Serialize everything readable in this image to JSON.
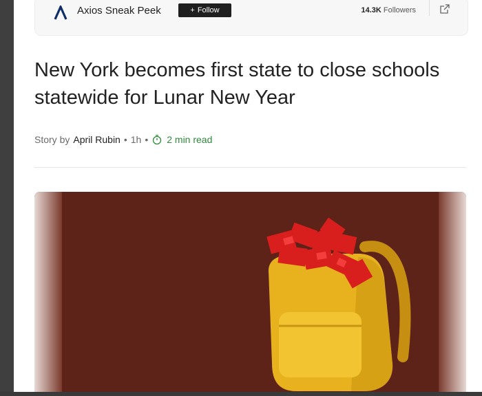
{
  "publisher": {
    "name": "Axios Sneak Peek",
    "follow_label": "Follow",
    "followers_count": "14.3K",
    "followers_label": "Followers"
  },
  "article": {
    "headline": "New York becomes first state to close schools statewide for Lunar New Year",
    "byline_prefix": "Story by",
    "author": "April Rubin",
    "age": "1h",
    "read_time": "2 min read"
  },
  "icons": {
    "publisher_logo": "axios-logo-icon",
    "follow": "plus-icon",
    "share": "open-external-icon",
    "read_time": "stopwatch-icon"
  },
  "colors": {
    "read_time": "#2e8b3a",
    "hero_background": "#5d2218",
    "backpack": "#e8b21e",
    "envelopes": "#d91e1e"
  }
}
